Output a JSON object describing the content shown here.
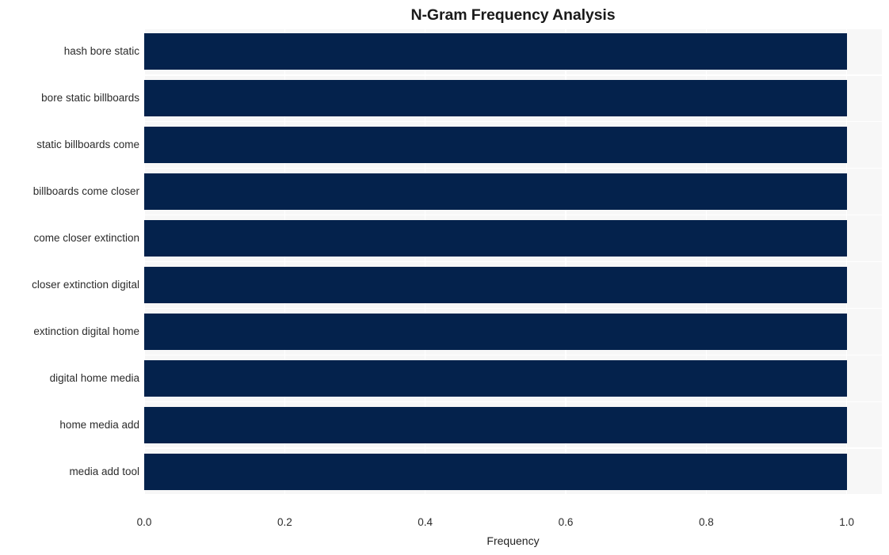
{
  "chart_data": {
    "type": "bar",
    "orientation": "horizontal",
    "title": "N-Gram Frequency Analysis",
    "xlabel": "Frequency",
    "ylabel": "",
    "categories": [
      "hash bore static",
      "bore static billboards",
      "static billboards come",
      "billboards come closer",
      "come closer extinction",
      "closer extinction digital",
      "extinction digital home",
      "digital home media",
      "home media add",
      "media add tool"
    ],
    "values": [
      1.0,
      1.0,
      1.0,
      1.0,
      1.0,
      1.0,
      1.0,
      1.0,
      1.0,
      1.0
    ],
    "xlim": [
      0.0,
      1.05
    ],
    "xticks": [
      0.0,
      0.2,
      0.4,
      0.6,
      0.8,
      1.0
    ],
    "xticklabels": [
      "0.0",
      "0.2",
      "0.4",
      "0.6",
      "0.8",
      "1.0"
    ],
    "grid": true,
    "grid_color": "#ffffff",
    "legend": null,
    "bar_color": "#04224c",
    "plot_background": "#f7f7f7",
    "figure_background": "#ffffff"
  }
}
